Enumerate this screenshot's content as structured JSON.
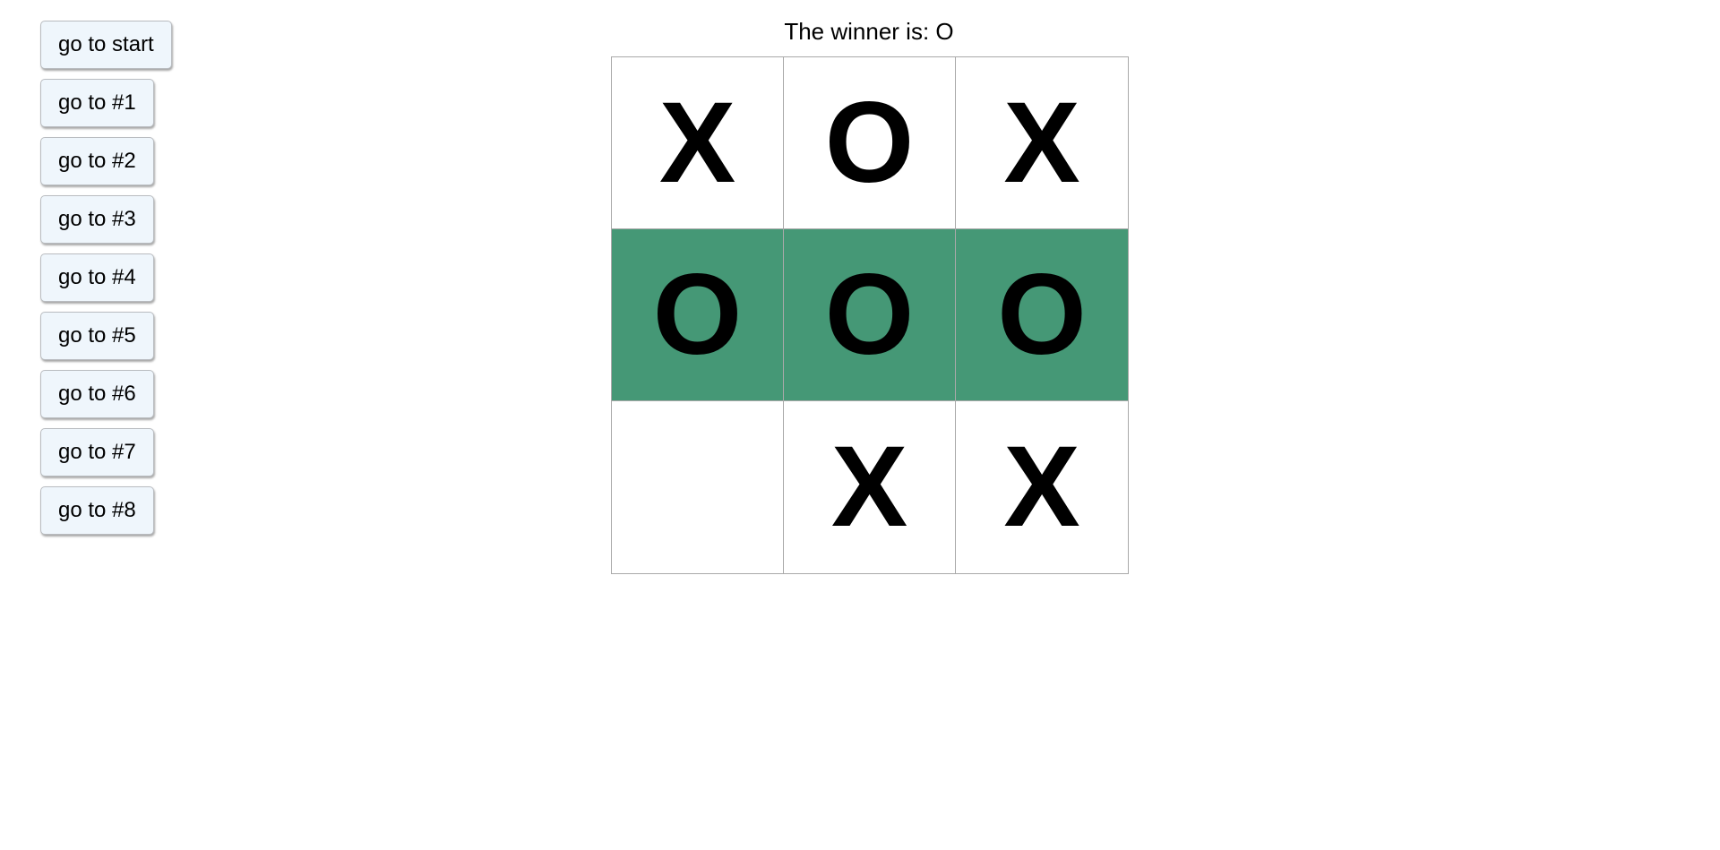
{
  "status": "The winner is: O",
  "colors": {
    "winning_highlight": "#459876",
    "button_bg": "#eff6fc"
  },
  "history": [
    {
      "label": "go to start"
    },
    {
      "label": "go to #1"
    },
    {
      "label": "go to #2"
    },
    {
      "label": "go to #3"
    },
    {
      "label": "go to #4"
    },
    {
      "label": "go to #5"
    },
    {
      "label": "go to #6"
    },
    {
      "label": "go to #7"
    },
    {
      "label": "go to #8"
    }
  ],
  "board": {
    "squares": [
      {
        "value": "X",
        "winning": false
      },
      {
        "value": "O",
        "winning": false
      },
      {
        "value": "X",
        "winning": false
      },
      {
        "value": "O",
        "winning": true
      },
      {
        "value": "O",
        "winning": true
      },
      {
        "value": "O",
        "winning": true
      },
      {
        "value": "",
        "winning": false
      },
      {
        "value": "X",
        "winning": false
      },
      {
        "value": "X",
        "winning": false
      }
    ]
  }
}
